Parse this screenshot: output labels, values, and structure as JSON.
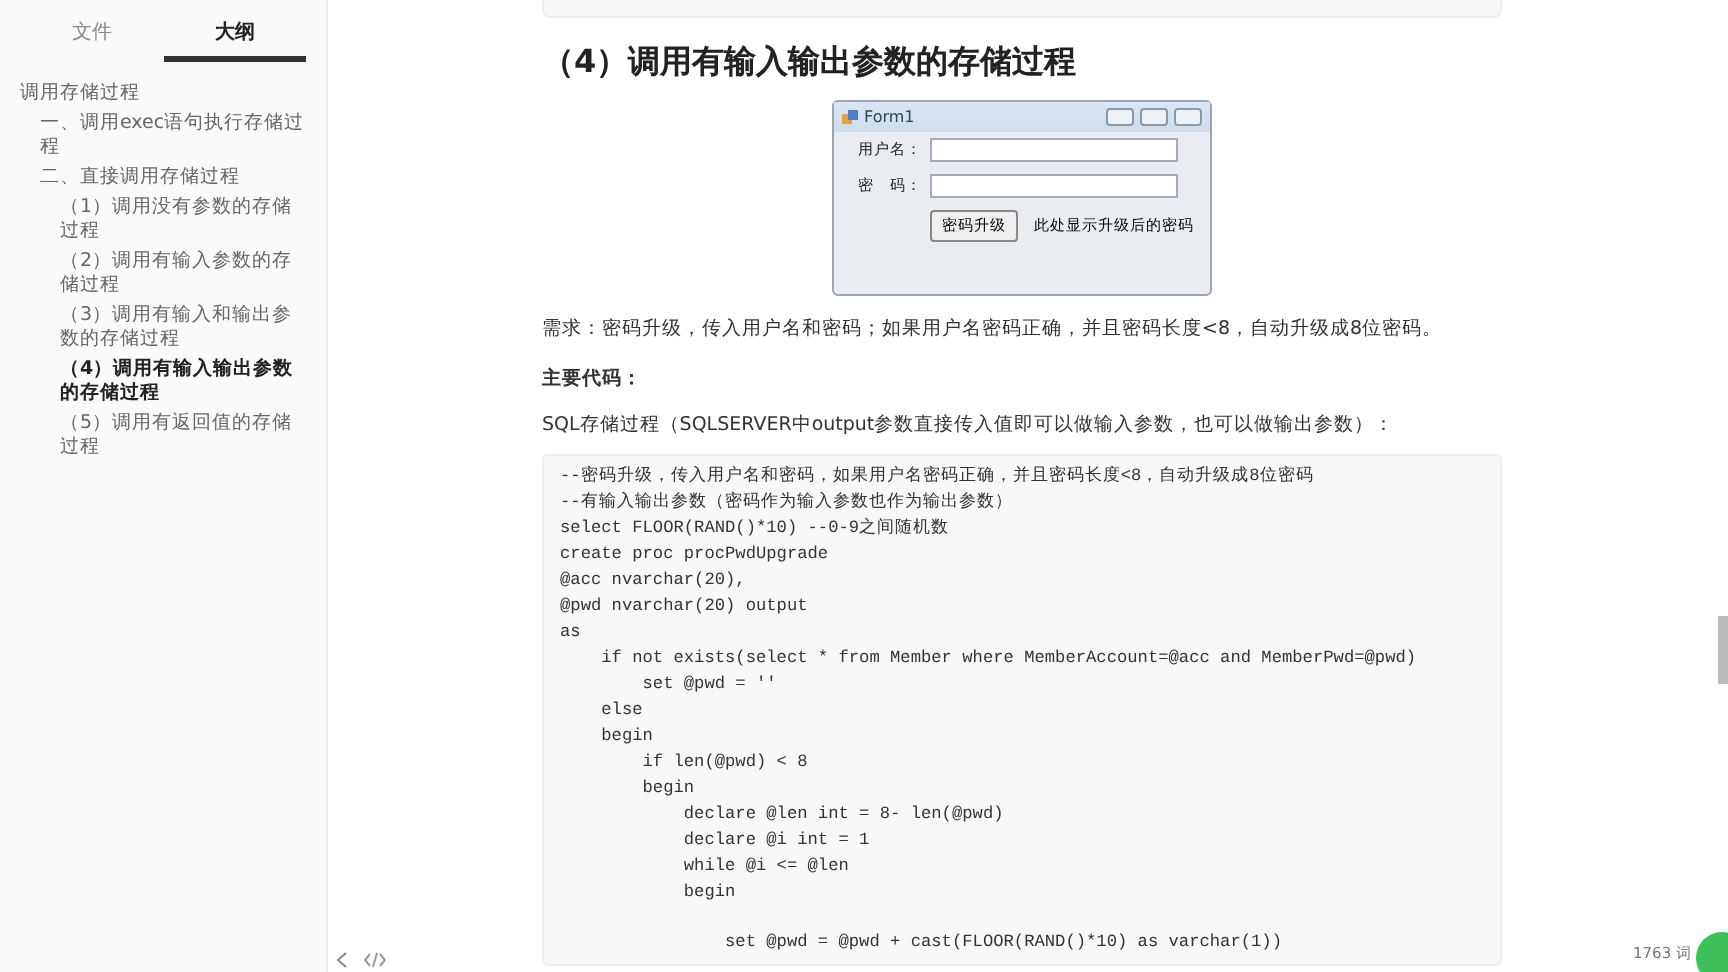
{
  "sidebar": {
    "tabs": [
      {
        "label": "文件",
        "selected": false
      },
      {
        "label": "大纲",
        "selected": true
      }
    ],
    "outline": [
      {
        "label": "调用存储过程",
        "selected": false,
        "children": [
          {
            "label": "一、调用exec语句执行存储过程",
            "selected": false
          },
          {
            "label": "二、直接调用存储过程",
            "selected": false,
            "children": [
              {
                "label": "（1）调用没有参数的存储过程",
                "selected": false
              },
              {
                "label": "（2）调用有输入参数的存储过程",
                "selected": false
              },
              {
                "label": "（3）调用有输入和输出参数的存储过程",
                "selected": false
              },
              {
                "label": "（4）调用有输入输出参数的存储过程",
                "selected": true
              },
              {
                "label": "（5）调用有返回值的存储过程",
                "selected": false
              }
            ]
          }
        ]
      }
    ]
  },
  "document": {
    "heading": "（4）调用有输入输出参数的存储过程",
    "form_window": {
      "title": "Form1",
      "fields": [
        {
          "label": "用户名："
        },
        {
          "label": "密　码："
        }
      ],
      "button": "密码升级",
      "result_label": "此处显示升级后的密码"
    },
    "requirement": "需求：密码升级，传入用户名和密码；如果用户名密码正确，并且密码长度<8，自动升级成8位密码。",
    "subheading": "主要代码：",
    "intro": "SQL存储过程（SQLSERVER中output参数直接传入值即可以做输入参数，也可以做输出参数）：",
    "code_lines": [
      "--密码升级，传入用户名和密码，如果用户名密码正确，并且密码长度<8，自动升级成8位密码",
      "--有输入输出参数（密码作为输入参数也作为输出参数）",
      "select FLOOR(RAND()*10) --0-9之间随机数",
      "create proc procPwdUpgrade",
      "@acc nvarchar(20),",
      "@pwd nvarchar(20) output",
      "as",
      "    if not exists(select * from Member where MemberAccount=@acc and MemberPwd=@pwd)",
      "        set @pwd = ''",
      "    else",
      "    begin",
      "        if len(@pwd) < 8",
      "        begin",
      "            declare @len int = 8- len(@pwd)",
      "            declare @i int = 1",
      "            while @i <= @len",
      "            begin"
    ],
    "code_lines_after_blank": [
      "                set @pwd = @pwd + cast(FLOOR(RAND()*10) as varchar(1))"
    ]
  },
  "footer": {
    "word_count": "1763 词"
  }
}
